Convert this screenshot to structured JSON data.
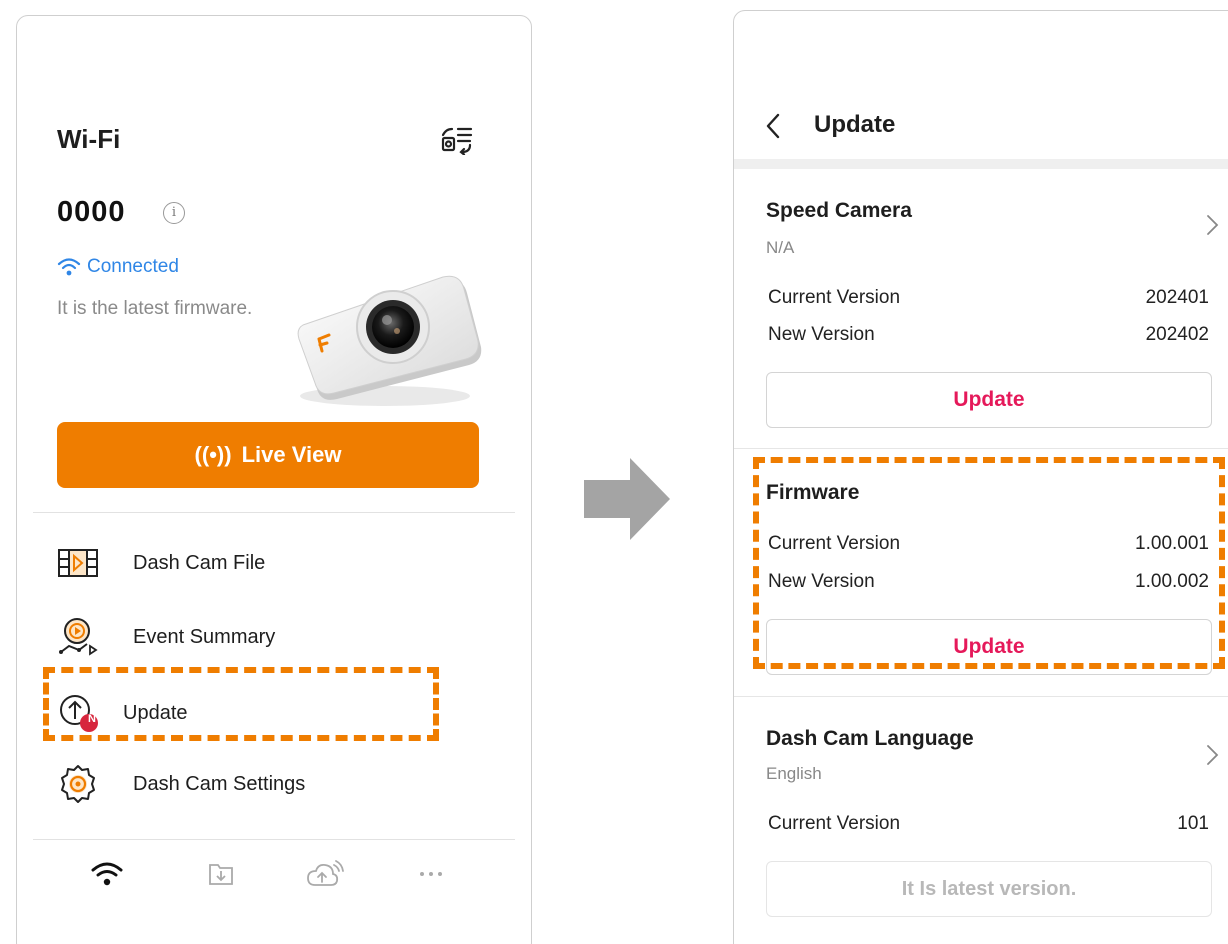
{
  "left_screen": {
    "title": "Wi-Fi",
    "device_name": "0000",
    "info_glyph": "i",
    "connection_status": "Connected",
    "firmware_status": "It is the latest firmware.",
    "live_view_glyph": "((•))",
    "live_view_label": "Live View",
    "menu": [
      {
        "label": "Dash Cam File",
        "icon": "film-file-icon"
      },
      {
        "label": "Event Summary",
        "icon": "event-play-icon"
      },
      {
        "label": "Update",
        "icon": "upload-arrow-icon",
        "badge": "N"
      },
      {
        "label": "Dash Cam Settings",
        "icon": "settings-gear-icon"
      }
    ],
    "tabs": [
      {
        "icon": "wifi-icon",
        "active": true
      },
      {
        "icon": "download-folder-icon",
        "active": false
      },
      {
        "icon": "cloud-upload-icon",
        "active": false
      },
      {
        "icon": "more-icon",
        "active": false
      }
    ]
  },
  "right_screen": {
    "title": "Update",
    "speed_camera": {
      "title": "Speed Camera",
      "subtitle": "N/A",
      "current_label": "Current Version",
      "current_value": "202401",
      "new_label": "New Version",
      "new_value": "202402",
      "button": "Update"
    },
    "firmware": {
      "title": "Firmware",
      "current_label": "Current Version",
      "current_value": "1.00.001",
      "new_label": "New Version",
      "new_value": "1.00.002",
      "button": "Update"
    },
    "language": {
      "title": "Dash Cam Language",
      "subtitle": "English",
      "current_label": "Current Version",
      "current_value": "101",
      "button": "It Is latest version."
    }
  },
  "colors": {
    "accent_orange": "#ef7d00",
    "update_pink": "#e5195a",
    "connected_blue": "#2f86e6",
    "badge_red": "#d7263d"
  }
}
